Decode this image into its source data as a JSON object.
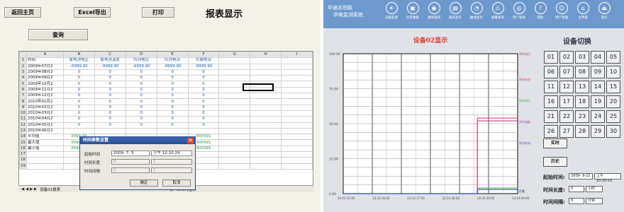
{
  "left": {
    "toolbar": {
      "back": "返回主页",
      "excel": "Excel导出",
      "print": "打印"
    },
    "title": "报表显示",
    "query": "查询",
    "columns": [
      "A",
      "B",
      "C",
      "D",
      "E",
      "F",
      "G",
      "H",
      "I"
    ],
    "header_row": [
      "时间",
      "蓄电池电压",
      "蓄电池温度",
      "阵列电压",
      "阵列电流",
      "负载电流"
    ],
    "rows": [
      [
        "2009年07月2",
        "-9999.90",
        "-9999.90",
        "-9999.90",
        "-9999.90",
        "-9999.90"
      ],
      [
        "2009年08月2",
        "0",
        "0",
        "0",
        "0",
        "0"
      ],
      [
        "2009年09月2",
        "0",
        "0",
        "0",
        "0",
        "0"
      ],
      [
        "2009年10月2",
        "0",
        "0",
        "0",
        "0",
        "0"
      ],
      [
        "2009年11月2",
        "0",
        "0",
        "0",
        "0",
        "0"
      ],
      [
        "2009年12月2",
        "0",
        "0",
        "0",
        "0",
        "0"
      ],
      [
        "2010年01月2",
        "0",
        "0",
        "0",
        "0",
        "0"
      ],
      [
        "2010年02月2",
        "0",
        "0",
        "0",
        "0",
        "0"
      ],
      [
        "2010年03月2",
        "0",
        "0",
        "0",
        "0",
        "0"
      ],
      [
        "2010年04月2",
        "0",
        "0",
        "0",
        "0",
        "0"
      ],
      [
        "2010年05月2",
        "0",
        "0",
        "0",
        "0",
        "0"
      ],
      [
        "2010年06月2",
        "",
        "",
        "",
        "",
        ""
      ]
    ],
    "summary": [
      [
        "平均值",
        "3999.90",
        "",
        "",
        "",
        "900391"
      ],
      [
        "最大值",
        "3999.90",
        "",
        "",
        "",
        "900391"
      ],
      [
        "最小值",
        "3999.90",
        "",
        "",
        "",
        "900391"
      ]
    ],
    "tabs": [
      "设备01报表",
      "表",
      "SOC时显示"
    ],
    "dialog": {
      "title": "时间参数设置",
      "close": "×",
      "start_label": "起始时间",
      "start_date": "2009- 7- 5",
      "start_time": "下午 12:10:24",
      "len_label": "时间长度",
      "len_value": "0",
      "len_unit": "1",
      "int_label": "时间间隔",
      "int_value": "1",
      "int_unit": "1",
      "ok": "确定",
      "cancel": "取消"
    }
  },
  "right": {
    "system": [
      "华通太阳能",
      "供电监测系统"
    ],
    "nav": [
      {
        "label": "设备监测",
        "icon": "☀"
      },
      {
        "label": "历史数据",
        "icon": "▣"
      },
      {
        "label": "故障查询",
        "icon": "◉"
      },
      {
        "label": "报表显示",
        "icon": "▤"
      },
      {
        "label": "曲线显示",
        "icon": "◔"
      },
      {
        "label": "报警查询",
        "icon": "⚠"
      },
      {
        "label": "用户登录",
        "icon": "◎"
      },
      {
        "label": "帮助",
        "icon": "?"
      },
      {
        "label": "用户管理",
        "icon": "☺"
      },
      {
        "label": "主界面",
        "icon": "⌂"
      },
      {
        "label": "退出",
        "icon": "⏏"
      }
    ],
    "chart_title": "设备02显示",
    "device_title": "设备切换",
    "devices": [
      "01",
      "02",
      "03",
      "04",
      "05",
      "06",
      "07",
      "08",
      "09",
      "10",
      "11",
      "12",
      "13",
      "14",
      "15",
      "16",
      "17",
      "18",
      "19",
      "20",
      "21",
      "22",
      "23",
      "24",
      "25",
      "26",
      "27",
      "28",
      "29",
      "30"
    ],
    "realtime": "实时",
    "history": "历史",
    "start_label": "起始时间:",
    "start_date": "2009- 9-22",
    "start_time": "上午 10:20:10",
    "len_label": "时间长度:",
    "len_value": "0",
    "len_unit": "小时",
    "int_label": "时间间隔:",
    "int_value": "0",
    "int_unit": "分钟",
    "colors": {
      "header": "#6d99cd",
      "title": "#e53b2b"
    }
  },
  "chart_data": {
    "type": "line",
    "title": "设备02显示",
    "y_ticks": [
      "100.00",
      "75.00",
      "50.00",
      "25.00",
      "0.00"
    ],
    "ylim": [
      0,
      100
    ],
    "x_ticks": [
      "14:33:35:00",
      "14:33:36:00",
      "14:33:37:00",
      "14:33:38:00",
      "14:33:39:00",
      "14:33:40:00"
    ],
    "series": [
      {
        "name": "蓄电池电压",
        "color": "#b0448f",
        "values": [
          0,
          0,
          0,
          0,
          0,
          0,
          0,
          0,
          0,
          0,
          0,
          0,
          0,
          0,
          0,
          0,
          0,
          0,
          0,
          0,
          52,
          52,
          52,
          52,
          52,
          52,
          52
        ]
      },
      {
        "name": "蓄电池温度",
        "color": "#55b83b",
        "values": [
          0,
          0,
          0,
          0,
          0,
          0,
          0,
          0,
          0,
          0,
          0,
          0,
          0,
          0,
          0,
          0,
          0,
          0,
          0,
          0,
          4,
          4,
          4,
          4,
          4,
          4,
          4
        ]
      },
      {
        "name": "阵列电流",
        "color": "#e0407a",
        "values": [
          0,
          0,
          0,
          0,
          0,
          0,
          0,
          0,
          0,
          0,
          0,
          0,
          0,
          0,
          0,
          0,
          0,
          0,
          0,
          0,
          54,
          54,
          54,
          54,
          54,
          54,
          54
        ]
      },
      {
        "name": "负载电流",
        "color": "#2a3fd0",
        "values": [
          0,
          0,
          0,
          0,
          0,
          0,
          0,
          0,
          0,
          0,
          0,
          0,
          0,
          0,
          0,
          0,
          0,
          0,
          0,
          0,
          3,
          3,
          3,
          3,
          3,
          3,
          0
        ]
      }
    ],
    "legend_labels": [
      "阵列电压",
      "阵列电流",
      "阵列电压",
      "阵列温度",
      "阵列电流",
      "负载"
    ]
  }
}
